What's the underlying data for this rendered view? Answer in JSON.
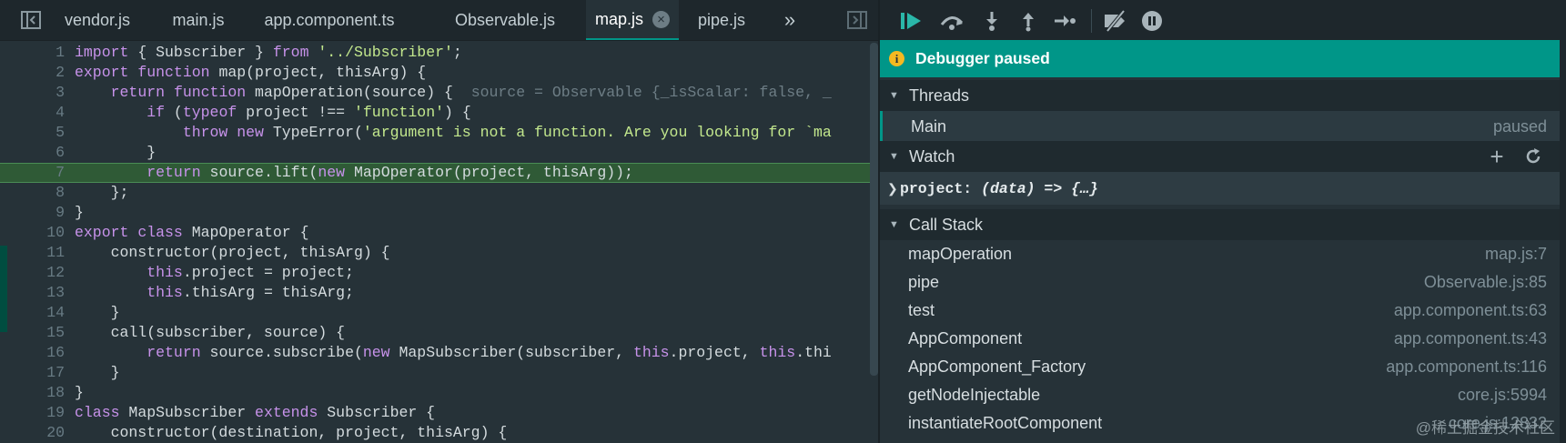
{
  "tabs": [
    {
      "label": "vendor.js"
    },
    {
      "label": "main.js"
    },
    {
      "label": "app.component.ts"
    },
    {
      "label": "Observable.js"
    },
    {
      "label": "map.js",
      "close": "×"
    },
    {
      "label": "pipe.js"
    }
  ],
  "tabs_more": "»",
  "code": {
    "lines": [
      {
        "n": "1",
        "segs": [
          [
            "kw",
            "import"
          ],
          [
            "ph",
            " { Subscriber } "
          ],
          [
            "kw",
            "from"
          ],
          [
            "ph",
            " "
          ],
          [
            "str",
            "'../Subscriber'"
          ],
          [
            "ph",
            ";"
          ]
        ]
      },
      {
        "n": "2",
        "segs": [
          [
            "kw",
            "export"
          ],
          [
            "ph",
            " "
          ],
          [
            "kw",
            "function"
          ],
          [
            "ph",
            " map(project, thisArg) {"
          ]
        ]
      },
      {
        "n": "3",
        "segs": [
          [
            "ph",
            "    "
          ],
          [
            "kw",
            "return"
          ],
          [
            "ph",
            " "
          ],
          [
            "kw",
            "function"
          ],
          [
            "ph",
            " mapOperation(source) {  "
          ],
          [
            "inl",
            "source = Observable {_isScalar: false, _"
          ]
        ]
      },
      {
        "n": "4",
        "segs": [
          [
            "ph",
            "        "
          ],
          [
            "kw",
            "if"
          ],
          [
            "ph",
            " ("
          ],
          [
            "kw",
            "typeof"
          ],
          [
            "ph",
            " project !== "
          ],
          [
            "str",
            "'function'"
          ],
          [
            "ph",
            ") {"
          ]
        ]
      },
      {
        "n": "5",
        "segs": [
          [
            "ph",
            "            "
          ],
          [
            "kw",
            "throw"
          ],
          [
            "ph",
            " "
          ],
          [
            "kw",
            "new"
          ],
          [
            "ph",
            " TypeError("
          ],
          [
            "str",
            "'argument is not a function. Are you looking for `ma"
          ]
        ]
      },
      {
        "n": "6",
        "segs": [
          [
            "ph",
            "        }"
          ]
        ]
      },
      {
        "n": "7",
        "segs": [
          [
            "ph",
            "        "
          ],
          [
            "kw",
            "return"
          ],
          [
            "ph",
            " source.lift("
          ],
          [
            "kw",
            "new"
          ],
          [
            "ph",
            " MapOperator(project, thisArg));"
          ]
        ],
        "hl": true
      },
      {
        "n": "8",
        "segs": [
          [
            "ph",
            "    };"
          ]
        ]
      },
      {
        "n": "9",
        "segs": [
          [
            "ph",
            "}"
          ]
        ]
      },
      {
        "n": "10",
        "segs": [
          [
            "kw",
            "export"
          ],
          [
            "ph",
            " "
          ],
          [
            "kw",
            "class"
          ],
          [
            "ph",
            " MapOperator {"
          ]
        ]
      },
      {
        "n": "11",
        "segs": [
          [
            "ph",
            "    constructor(project, thisArg) {"
          ]
        ]
      },
      {
        "n": "12",
        "segs": [
          [
            "ph",
            "        "
          ],
          [
            "kw",
            "this"
          ],
          [
            "ph",
            ".project = project;"
          ]
        ]
      },
      {
        "n": "13",
        "segs": [
          [
            "ph",
            "        "
          ],
          [
            "kw",
            "this"
          ],
          [
            "ph",
            ".thisArg = thisArg;"
          ]
        ]
      },
      {
        "n": "14",
        "segs": [
          [
            "ph",
            "    }"
          ]
        ]
      },
      {
        "n": "15",
        "segs": [
          [
            "ph",
            "    call(subscriber, source) {"
          ]
        ]
      },
      {
        "n": "16",
        "segs": [
          [
            "ph",
            "        "
          ],
          [
            "kw",
            "return"
          ],
          [
            "ph",
            " source.subscribe("
          ],
          [
            "kw",
            "new"
          ],
          [
            "ph",
            " MapSubscriber(subscriber, "
          ],
          [
            "kw",
            "this"
          ],
          [
            "ph",
            ".project, "
          ],
          [
            "kw",
            "this"
          ],
          [
            "ph",
            ".thi"
          ]
        ]
      },
      {
        "n": "17",
        "segs": [
          [
            "ph",
            "    }"
          ]
        ]
      },
      {
        "n": "18",
        "segs": [
          [
            "ph",
            "}"
          ]
        ]
      },
      {
        "n": "19",
        "segs": [
          [
            "kw",
            "class"
          ],
          [
            "ph",
            " MapSubscriber "
          ],
          [
            "kw",
            "extends"
          ],
          [
            "ph",
            " Subscriber {"
          ]
        ]
      },
      {
        "n": "20",
        "segs": [
          [
            "ph",
            "    constructor(destination, project, thisArg) {"
          ]
        ]
      }
    ]
  },
  "debugger": {
    "banner": "Debugger paused",
    "banner_icon": "i",
    "threads": {
      "title": "Threads",
      "items": [
        {
          "name": "Main",
          "status": "paused"
        }
      ]
    },
    "watch": {
      "title": "Watch",
      "add": "+",
      "expr_name": "project: ",
      "expr_value": "(data) => {…}"
    },
    "call_stack": {
      "title": "Call Stack",
      "frames": [
        {
          "name": "mapOperation",
          "loc": "map.js:7"
        },
        {
          "name": "pipe",
          "loc": "Observable.js:85"
        },
        {
          "name": "test",
          "loc": "app.component.ts:63"
        },
        {
          "name": "AppComponent",
          "loc": "app.component.ts:43"
        },
        {
          "name": "AppComponent_Factory",
          "loc": "app.component.ts:116"
        },
        {
          "name": "getNodeInjectable",
          "loc": "core.js:5994"
        },
        {
          "name": "instantiateRootComponent",
          "loc": "core.js:12832"
        }
      ]
    }
  },
  "watermark": "@稀土掘金技术社区",
  "colors": {
    "accent": "#009688",
    "keyword": "#c792ea",
    "string": "#c3e88d",
    "highlight": "#2f5a36"
  }
}
